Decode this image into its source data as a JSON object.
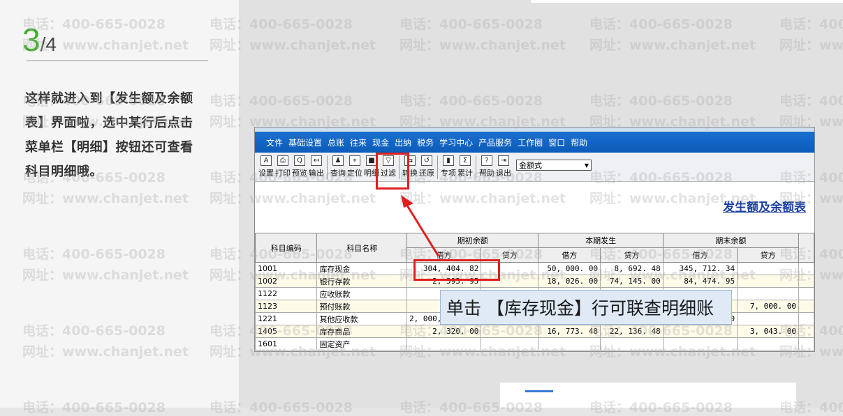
{
  "step": {
    "current": "3",
    "total": "/4"
  },
  "instruction": "这样就进入到【发生额及余额表】界面啦，选中某行后点击菜单栏【明细】按钮还可查看科目明细哦。",
  "watermark": {
    "phone": "电话：400-665-0028",
    "site": "网址：www.chanjet.net"
  },
  "app": {
    "menu": [
      "文件",
      "基础设置",
      "总账",
      "往来",
      "现金",
      "出纳",
      "税务",
      "学习中心",
      "产品服务",
      "工作圈",
      "窗口",
      "帮助"
    ],
    "toolbar": [
      {
        "label": "设置",
        "icon": "A"
      },
      {
        "label": "打印",
        "icon": "⎙"
      },
      {
        "label": "预览",
        "icon": "Q"
      },
      {
        "label": "输出",
        "icon": "↤"
      },
      {
        "label": "查询",
        "icon": "♟"
      },
      {
        "label": "定位",
        "icon": "⌖"
      },
      {
        "label": "明细",
        "icon": "■"
      },
      {
        "label": "过滤",
        "icon": "▽"
      },
      {
        "label": "转换",
        "icon": "⇆"
      },
      {
        "label": "还原",
        "icon": "↺"
      },
      {
        "label": "专项",
        "icon": "▮"
      },
      {
        "label": "累计",
        "icon": "Σ"
      },
      {
        "label": "帮助",
        "icon": "?"
      },
      {
        "label": "退出",
        "icon": "⇥"
      }
    ],
    "mode_select": "金额式",
    "report_title": "发生额及余额表",
    "headers": {
      "code": "科目编码",
      "name": "科目名称",
      "opening": "期初余额",
      "current": "本期发生",
      "closing": "期末余额",
      "debit": "借方",
      "credit": "贷方"
    },
    "rows": [
      [
        "1001",
        "库存现金",
        "304, 404. 82",
        "",
        "50, 000. 00",
        "8, 692. 48",
        "345, 712. 34",
        ""
      ],
      [
        "1002",
        "银行存款",
        "2, 593. 95",
        "",
        "18, 026. 00",
        "74, 145. 00",
        "84, 474. 95",
        ""
      ],
      [
        "1122",
        "应收账款",
        "",
        "",
        "",
        "",
        "",
        ""
      ],
      [
        "1123",
        "预付账款",
        "",
        "",
        "",
        "",
        "",
        "7, 000. 00"
      ],
      [
        "1221",
        "其他应收款",
        "2, 000, 000. 00",
        "",
        "",
        "",
        "2, 000, 000. 00",
        ""
      ],
      [
        "1405",
        "库存商品",
        "2, 320. 00",
        "",
        "16, 773. 48",
        "22, 136. 48",
        "",
        "3, 043. 00"
      ],
      [
        "1601",
        "固定资产",
        "",
        "",
        "",
        "",
        "",
        ""
      ]
    ]
  },
  "callout": "单击 【库存现金】行可联查明细账",
  "colors": {
    "accent_green": "#3fae2a",
    "highlight_red": "#e02020",
    "menu_blue": "#0c5cb8"
  }
}
